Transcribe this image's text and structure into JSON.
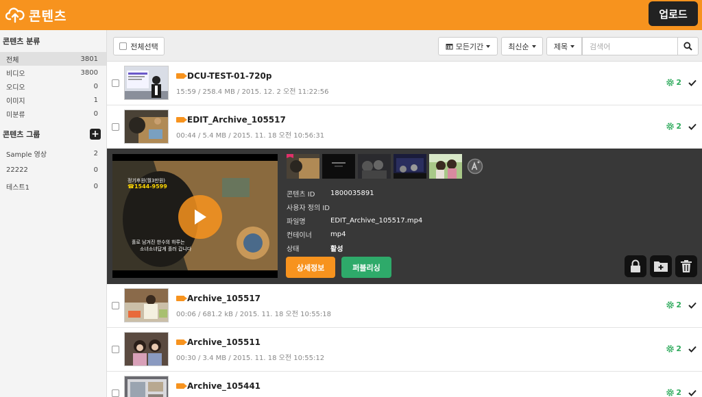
{
  "header": {
    "title": "콘텐츠",
    "upload_label": "업로드"
  },
  "sidebar": {
    "category_title": "콘텐츠 분류",
    "categories": [
      {
        "label": "전체",
        "count": "3801"
      },
      {
        "label": "비디오",
        "count": "3800"
      },
      {
        "label": "오디오",
        "count": "0"
      },
      {
        "label": "이미지",
        "count": "1"
      },
      {
        "label": "미분류",
        "count": "0"
      }
    ],
    "group_title": "콘텐츠 그룹",
    "add_label": "+",
    "groups": [
      {
        "label": "Sample 영상",
        "count": "2"
      },
      {
        "label": "22222",
        "count": "0"
      },
      {
        "label": "테스트1",
        "count": "0"
      }
    ]
  },
  "toolbar": {
    "select_all": "전체선택",
    "period": "모든기간",
    "sort": "최신순",
    "field": "제목",
    "search_placeholder": "검색어"
  },
  "items": [
    {
      "title": "DCU-TEST-01-720p",
      "meta": "15:59  /  258.4 MB  /  2015. 12. 2 오전 11:22:56",
      "gear_count": "2"
    },
    {
      "title": "EDIT_Archive_105517",
      "meta": "00:44  /  5.4 MB  /  2015. 11. 18 오전 10:56:31",
      "gear_count": "2"
    },
    {
      "title": "Archive_105517",
      "meta": "00:06  /  681.2 kB  /  2015. 11. 18 오전 10:55:18",
      "gear_count": "2"
    },
    {
      "title": "Archive_105511",
      "meta": "00:30  /  3.4 MB  /  2015. 11. 18 오전 10:55:12",
      "gear_count": "2"
    },
    {
      "title": "Archive_105441",
      "meta": "",
      "gear_count": "2"
    }
  ],
  "detail": {
    "video_text_1": "정기후원(월3만원)",
    "video_text_2": "☎1544-9599",
    "video_text_3": "홀로 남겨진 한수의 하루는",
    "video_text_4": "소녀소녀답게 흘러 갑니다",
    "fields": [
      {
        "key": "콘텐츠 ID",
        "value": "1800035891"
      },
      {
        "key": "사용자 정의 ID",
        "value": ""
      },
      {
        "key": "파일명",
        "value": "EDIT_Archive_105517.mp4"
      },
      {
        "key": "컨테이너",
        "value": "mp4"
      },
      {
        "key": "상태",
        "value": "활성"
      }
    ],
    "detail_label": "상세정보",
    "publish_label": "퍼블리싱"
  },
  "colors": {
    "accent": "#f7931e",
    "green": "#2eaa6a",
    "dark": "#383838"
  }
}
